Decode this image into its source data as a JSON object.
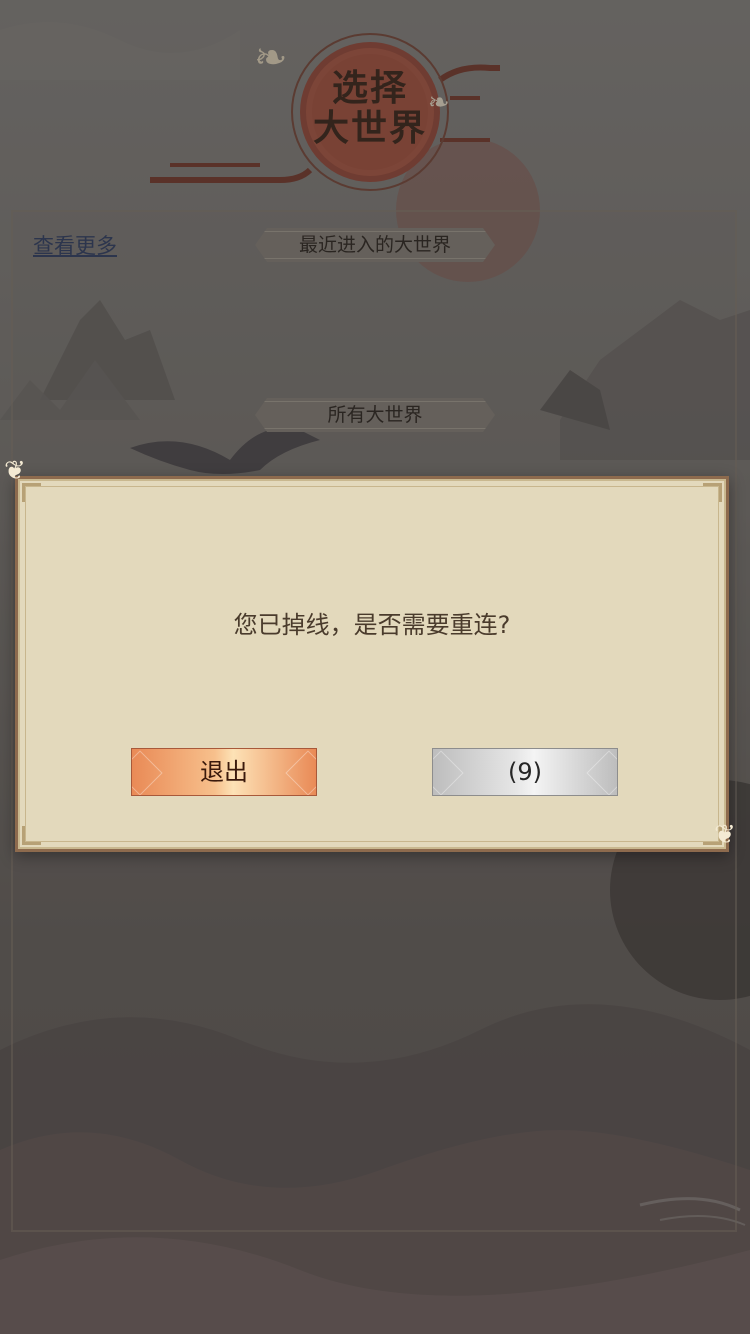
{
  "header": {
    "title_line1": "选择",
    "title_line2": "大世界"
  },
  "panel": {
    "view_more_link": "查看更多",
    "recent_section_title": "最近进入的大世界",
    "all_section_title": "所有大世界"
  },
  "dialog": {
    "message": "您已掉线，是否需要重连?",
    "exit_button": "退出",
    "reconnect_button": "(9)"
  },
  "icons": {
    "emblem": "red-sun-emblem-icon",
    "butterfly": "butterfly-icon",
    "crane": "crane-icon"
  },
  "colors": {
    "dialog_bg": "#e3d9bc",
    "dialog_border": "#8d6a4d",
    "exit_button": "#e98a56",
    "reconnect_button": "#d8d8d8"
  }
}
